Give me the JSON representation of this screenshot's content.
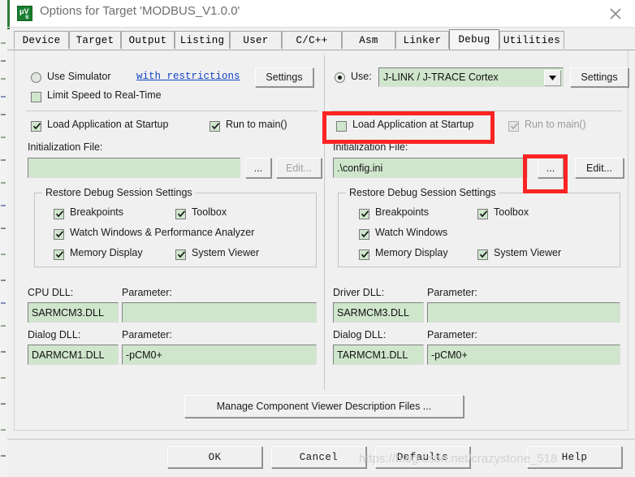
{
  "window": {
    "title": "Options for Target 'MODBUS_V1.0.0'",
    "app_icon": "keil-uvision-icon",
    "icon_glyph_top": "μV",
    "icon_glyph_bottom": "s",
    "close_icon": "close-icon"
  },
  "tabs": [
    {
      "label": "Device",
      "active": false
    },
    {
      "label": "Target",
      "active": false
    },
    {
      "label": "Output",
      "active": false
    },
    {
      "label": "Listing",
      "active": false
    },
    {
      "label": "User",
      "active": false
    },
    {
      "label": "C/C++",
      "active": false
    },
    {
      "label": "Asm",
      "active": false
    },
    {
      "label": "Linker",
      "active": false
    },
    {
      "label": "Debug",
      "active": true
    },
    {
      "label": "Utilities",
      "active": false
    }
  ],
  "left_panel": {
    "use_simulator": {
      "label": "Use Simulator",
      "checked": false
    },
    "restrictions_link": "with restrictions",
    "settings_button": "Settings",
    "limit_speed": {
      "label": "Limit Speed to Real-Time",
      "checked": false
    },
    "load_app": {
      "label": "Load Application at Startup",
      "checked": true
    },
    "run_to_main": {
      "label": "Run to main()",
      "checked": true
    },
    "init_file_label": "Initialization File:",
    "init_file_value": "",
    "browse_button": "...",
    "edit_button": "Edit...",
    "edit_enabled": false,
    "restore_group": {
      "title": "Restore Debug Session Settings",
      "items": [
        {
          "label": "Breakpoints",
          "checked": true
        },
        {
          "label": "Toolbox",
          "checked": true
        },
        {
          "label": "Watch Windows & Performance Analyzer",
          "checked": true
        },
        {
          "label": "Memory Display",
          "checked": true
        },
        {
          "label": "System Viewer",
          "checked": true
        }
      ]
    },
    "cpu_dll_label": "CPU DLL:",
    "cpu_dll_value": "SARMCM3.DLL",
    "cpu_param_label": "Parameter:",
    "cpu_param_value": "",
    "dialog_dll_label": "Dialog DLL:",
    "dialog_dll_value": "DARMCM1.DLL",
    "dialog_param_label": "Parameter:",
    "dialog_param_value": "-pCM0+"
  },
  "right_panel": {
    "use_label": "Use:",
    "use_checked": true,
    "driver_selected": "J-LINK / J-TRACE Cortex",
    "dropdown_icon": "chevron-down-icon",
    "settings_button": "Settings",
    "load_app": {
      "label": "Load Application at Startup",
      "checked": false
    },
    "run_to_main": {
      "label": "Run to main()",
      "checked": true,
      "enabled": false
    },
    "init_file_label": "Initialization File:",
    "init_file_value": ".\\config.ini",
    "browse_button": "...",
    "edit_button": "Edit...",
    "edit_enabled": true,
    "restore_group": {
      "title": "Restore Debug Session Settings",
      "items": [
        {
          "label": "Breakpoints",
          "checked": true
        },
        {
          "label": "Toolbox",
          "checked": true
        },
        {
          "label": "Watch Windows",
          "checked": true
        },
        {
          "label": "Memory Display",
          "checked": true
        },
        {
          "label": "System Viewer",
          "checked": true
        }
      ]
    },
    "driver_dll_label": "Driver DLL:",
    "driver_dll_value": "SARMCM3.DLL",
    "driver_param_label": "Parameter:",
    "driver_param_value": "",
    "dialog_dll_label": "Dialog DLL:",
    "dialog_dll_value": "TARMCM1.DLL",
    "dialog_param_label": "Parameter:",
    "dialog_param_value": "-pCM0+"
  },
  "manage_button": "Manage Component Viewer Description Files ...",
  "footer": {
    "ok": "OK",
    "cancel": "Cancel",
    "defaults": "Defaults",
    "help": "Help"
  },
  "watermark": "https://blog.csdn.net/crazystone_518",
  "colors": {
    "field_green": "#cfe6cd",
    "dialog_bg": "#f0f0f0",
    "annotation_red": "#fb2323",
    "link_blue": "#1243c8",
    "icon_green": "#1a7d32"
  }
}
